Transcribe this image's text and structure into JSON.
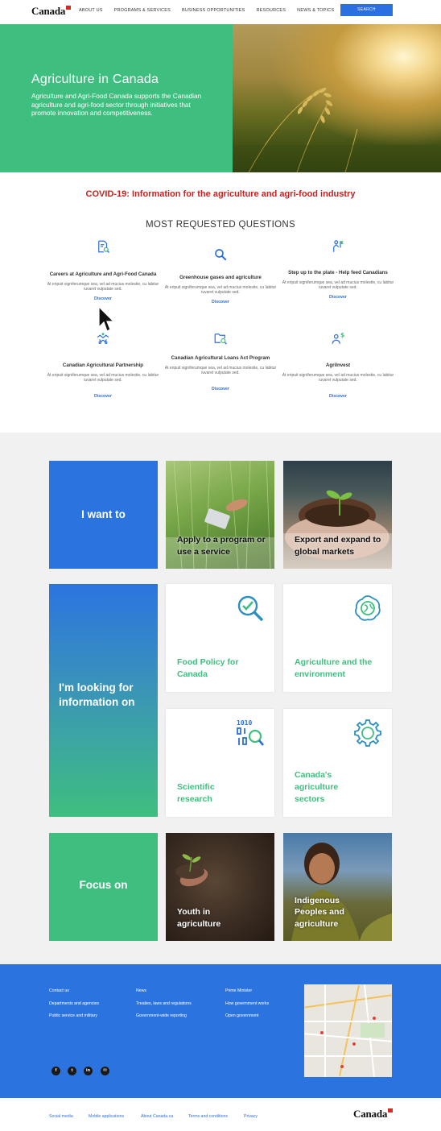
{
  "header": {
    "logo": "Canada",
    "nav": [
      "ABOUT US",
      "PROGRAMS & SERVICES",
      "BUSINESS OPPORTUNITIES",
      "RESOURCES",
      "NEWS & TOPICS"
    ],
    "search_label": "SEARCH"
  },
  "hero": {
    "title": "Agriculture in Canada",
    "description": "Agriculture and Agri-Food Canada supports the Canadian agriculture and agri-food sector through initiatives that promote innovation and competitiveness."
  },
  "covid_banner": "COVID-19: Information for the agriculture and agri-food industry",
  "questions": {
    "title": "MOST REQUESTED QUESTIONS",
    "items": [
      {
        "title": "Careers at Agriculture and Agri-Food Canada",
        "text": "At eripuit signiferumque sea, vel ad mucius molestie, cu labitur iuvaret vulputate sed.",
        "link": "Discover",
        "icon": "document-search-icon"
      },
      {
        "title": "Greenhouse gases and agriculture",
        "text": "At eripuit signiferumque sea, vel ad mucius molestie, cu labitur iuvaret vulputate sed.",
        "link": "Discover",
        "icon": "search-icon"
      },
      {
        "title": "Step up to the plate - Help feed Canadians",
        "text": "At eripuit signiferumque sea, vel ad mucius molestie, cu labitur iuvaret vulputate sed.",
        "link": "Discover",
        "icon": "person-flag-icon"
      },
      {
        "title": "Canadian Agricultural Partnership",
        "text": "At eripuit signiferumque sea, vel ad mucius molestie, cu labitur iuvaret vulputate sed.",
        "link": "Discover",
        "icon": "handshake-icon"
      },
      {
        "title": "Canadian Agricultural Loans Act Program",
        "text": "At eripuit signiferumque sea, vel ad mucius molestie, cu labitur iuvaret vulputate sed.",
        "link": "Discover",
        "icon": "folder-search-icon"
      },
      {
        "title": "AgriInvest",
        "text": "At eripuit signiferumque sea, vel ad mucius molestie, cu labitur iuvaret vulputate sed.",
        "link": "Discover",
        "icon": "person-dollar-icon"
      }
    ]
  },
  "tiles": {
    "i_want_to": "I want to",
    "apply": "Apply to a program or use a service",
    "export": "Export and expand to global markets",
    "looking_for": "I'm looking for information on",
    "food_policy": "Food Policy for Canada",
    "environment": "Agriculture and the environment",
    "scientific": "Scientific research",
    "sectors": "Canada's agriculture sectors",
    "focus_on": "Focus on",
    "youth": "Youth in agriculture",
    "indigenous": "Indigenous Peoples and agriculture"
  },
  "footer": {
    "col1": [
      "Contact us",
      "Departments and agencies",
      "Public service and military"
    ],
    "col2": [
      "News",
      "Treaties, laws and regulations",
      "Government-wide reporting"
    ],
    "col3": [
      "Prime Minister",
      "How government works",
      "Open government"
    ],
    "social": [
      "facebook-icon",
      "twitter-icon",
      "linkedin-icon",
      "email-icon"
    ],
    "bottom_links": [
      "Social media",
      "Mobile applications",
      "About Canada.ca",
      "Terms and conditions",
      "Privacy"
    ],
    "logo": "Canada"
  },
  "colors": {
    "brand_green": "#3ebf7f",
    "brand_blue": "#2b74e0",
    "covid_red": "#c8211e"
  }
}
